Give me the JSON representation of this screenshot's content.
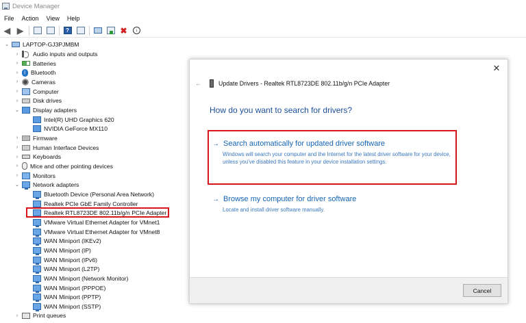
{
  "window": {
    "title": "Device Manager"
  },
  "menu": [
    "File",
    "Action",
    "View",
    "Help"
  ],
  "tree": {
    "root": "LAPTOP-GJ3PJMBM",
    "items": [
      {
        "label": "Audio inputs and outputs",
        "icon": "speaker-icon",
        "exp": "›"
      },
      {
        "label": "Batteries",
        "icon": "battery-icon",
        "exp": "›"
      },
      {
        "label": "Bluetooth",
        "icon": "bluetooth-icon",
        "exp": "›"
      },
      {
        "label": "Cameras",
        "icon": "camera-icon",
        "exp": "›"
      },
      {
        "label": "Computer",
        "icon": "computer-icon",
        "exp": "›"
      },
      {
        "label": "Disk drives",
        "icon": "disk-drive-icon",
        "exp": "›"
      },
      {
        "label": "Display adapters",
        "icon": "display-adapter-icon",
        "exp": "⌄"
      },
      {
        "label": "Intel(R) UHD Graphics 620",
        "icon": "display-adapter-icon",
        "child": true
      },
      {
        "label": "NVIDIA GeForce MX110",
        "icon": "display-adapter-icon",
        "child": true
      },
      {
        "label": "Firmware",
        "icon": "firmware-icon",
        "exp": "›"
      },
      {
        "label": "Human Interface Devices",
        "icon": "hid-icon",
        "exp": "›"
      },
      {
        "label": "Keyboards",
        "icon": "keyboard-icon",
        "exp": "›"
      },
      {
        "label": "Mice and other pointing devices",
        "icon": "mouse-icon",
        "exp": "›"
      },
      {
        "label": "Monitors",
        "icon": "monitor-icon",
        "exp": "›"
      },
      {
        "label": "Network adapters",
        "icon": "network-adapter-icon",
        "exp": "⌄"
      },
      {
        "label": "Bluetooth Device (Personal Area Network)",
        "icon": "network-adapter-icon",
        "child": true
      },
      {
        "label": "Realtek PCIe GbE Family Controller",
        "icon": "network-adapter-icon",
        "child": true
      },
      {
        "label": "Realtek RTL8723DE 802.11b/g/n PCIe Adapter",
        "icon": "network-adapter-icon",
        "child": true,
        "selected": true
      },
      {
        "label": "VMware Virtual Ethernet Adapter for VMnet1",
        "icon": "network-adapter-icon",
        "child": true
      },
      {
        "label": "VMware Virtual Ethernet Adapter for VMnet8",
        "icon": "network-adapter-icon",
        "child": true
      },
      {
        "label": "WAN Miniport (IKEv2)",
        "icon": "network-adapter-icon",
        "child": true
      },
      {
        "label": "WAN Miniport (IP)",
        "icon": "network-adapter-icon",
        "child": true
      },
      {
        "label": "WAN Miniport (IPv6)",
        "icon": "network-adapter-icon",
        "child": true
      },
      {
        "label": "WAN Miniport (L2TP)",
        "icon": "network-adapter-icon",
        "child": true
      },
      {
        "label": "WAN Miniport (Network Monitor)",
        "icon": "network-adapter-icon",
        "child": true
      },
      {
        "label": "WAN Miniport (PPPOE)",
        "icon": "network-adapter-icon",
        "child": true
      },
      {
        "label": "WAN Miniport (PPTP)",
        "icon": "network-adapter-icon",
        "child": true
      },
      {
        "label": "WAN Miniport (SSTP)",
        "icon": "network-adapter-icon",
        "child": true
      },
      {
        "label": "Print queues",
        "icon": "printer-icon",
        "exp": "›"
      }
    ]
  },
  "dialog": {
    "title": "Update Drivers - Realtek RTL8723DE 802.11b/g/n PCIe Adapter",
    "question": "How do you want to search for drivers?",
    "option1": {
      "title": "Search automatically for updated driver software",
      "desc": "Windows will search your computer and the Internet for the latest driver software for your device, unless you've disabled this feature in your device installation settings."
    },
    "option2": {
      "title": "Browse my computer for driver software",
      "desc": "Locate and install driver software manually."
    },
    "cancel": "Cancel",
    "close_glyph": "✕",
    "back_glyph": "←",
    "arrow_glyph": "→"
  },
  "colors": {
    "accent": "#1464b4",
    "highlight": "#d8141b"
  }
}
